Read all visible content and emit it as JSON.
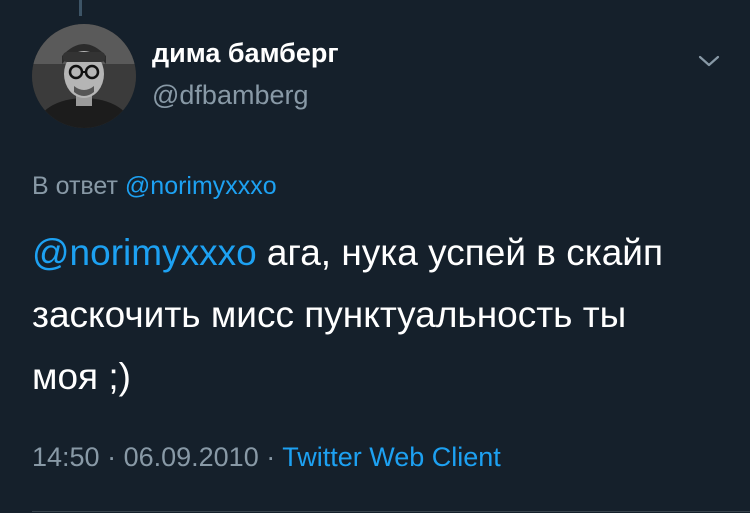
{
  "author": {
    "display_name": "дима бамберг",
    "handle": "@dfbamberg"
  },
  "reply": {
    "prefix": "В ответ",
    "mention": "@norimyxxxo"
  },
  "tweet": {
    "mention": "@norimyxxxo",
    "body": " ага, нука успей в скайп заскочить мисс пунктуальность ты моя ;)"
  },
  "meta": {
    "time": "14:50",
    "sep1": " · ",
    "date": "06.09.2010",
    "sep2": " · ",
    "source": "Twitter Web Client"
  },
  "colors": {
    "background": "#15202b",
    "accent": "#1da1f2",
    "secondary_text": "#8899a6"
  },
  "icons": {
    "menu": "chevron-down-icon"
  }
}
